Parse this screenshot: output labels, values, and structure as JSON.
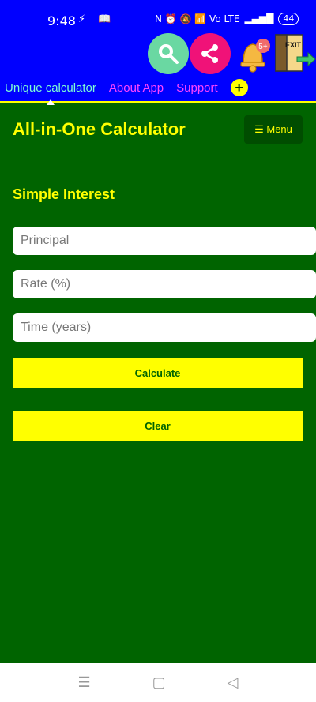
{
  "status_bar": {
    "time": "9:48",
    "left_icons": "⚡ 📖",
    "right_icons": "N ⏰ 🔕 📶 Vo LTE",
    "battery": "44"
  },
  "toolbar": {
    "search_icon": "search-icon",
    "share_icon": "share-icon",
    "notification_badge": "5+",
    "exit_label": "EXIT"
  },
  "tabs": [
    {
      "label": "Unique calculator",
      "active": true
    },
    {
      "label": "About App",
      "active": false
    },
    {
      "label": "Support",
      "active": false
    }
  ],
  "add_tab_label": "+",
  "app": {
    "title": "All-in-One Calculator",
    "menu_label": "☰ Menu",
    "section_title": "Simple Interest"
  },
  "form": {
    "principal_placeholder": "Principal",
    "rate_placeholder": "Rate (%)",
    "time_placeholder": "Time (years)",
    "calculate_label": "Calculate",
    "clear_label": "Clear"
  },
  "navbar": {
    "menu_glyph": "☰",
    "home_glyph": "▢",
    "back_glyph": "◁"
  },
  "colors": {
    "accent": "#ffff00",
    "background": "#006400",
    "topbar": "#0000ff"
  }
}
